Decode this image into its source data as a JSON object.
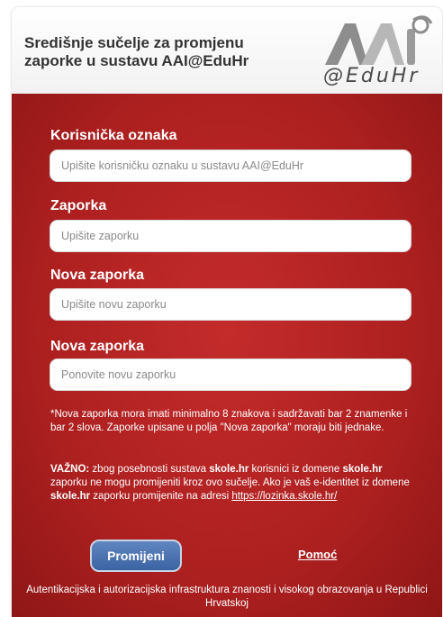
{
  "header": {
    "title": "Središnje sučelje za promjenu zaporke u sustavu AAI@EduHr",
    "logo_text": "@EduHr"
  },
  "form": {
    "username_label": "Korisnička oznaka",
    "username_placeholder": "Upišite korisničku oznaku u sustavu AAI@EduHr",
    "password_label": "Zaporka",
    "password_placeholder": "Upišite zaporku",
    "new_password_label": "Nova zaporka",
    "new_password_placeholder": "Upišite novu zaporku",
    "repeat_password_label": "Nova zaporka",
    "repeat_password_placeholder": "Ponovite novu zaporku"
  },
  "notes": {
    "requirement": "*Nova zaporka mora imati minimalno 8 znakova i sadržavati bar 2 znamenke i bar 2 slova. Zaporke upisane u polja \"Nova zaporka\" moraju biti jednake.",
    "important_label": "VAŽNO:",
    "important_1": " zbog posebnosti sustava ",
    "domain": "skole.hr",
    "important_2": " korisnici iz domene ",
    "important_3": " zaporku ne mogu promijeniti kroz ovo sučelje. Ako je vaš e-identitet iz domene ",
    "important_4": " zaporku promijenite na adresi ",
    "link": "https://lozinka.skole.hr/"
  },
  "actions": {
    "submit_label": "Promijeni",
    "help_label": "Pomoć"
  },
  "footer": {
    "text": "Autentikacijska i autorizacijska infrastruktura znanosti i visokog obrazovanja u Republici Hrvatskoj"
  },
  "colors": {
    "panel_red": "#b52424",
    "button_blue": "#4a70ae"
  }
}
